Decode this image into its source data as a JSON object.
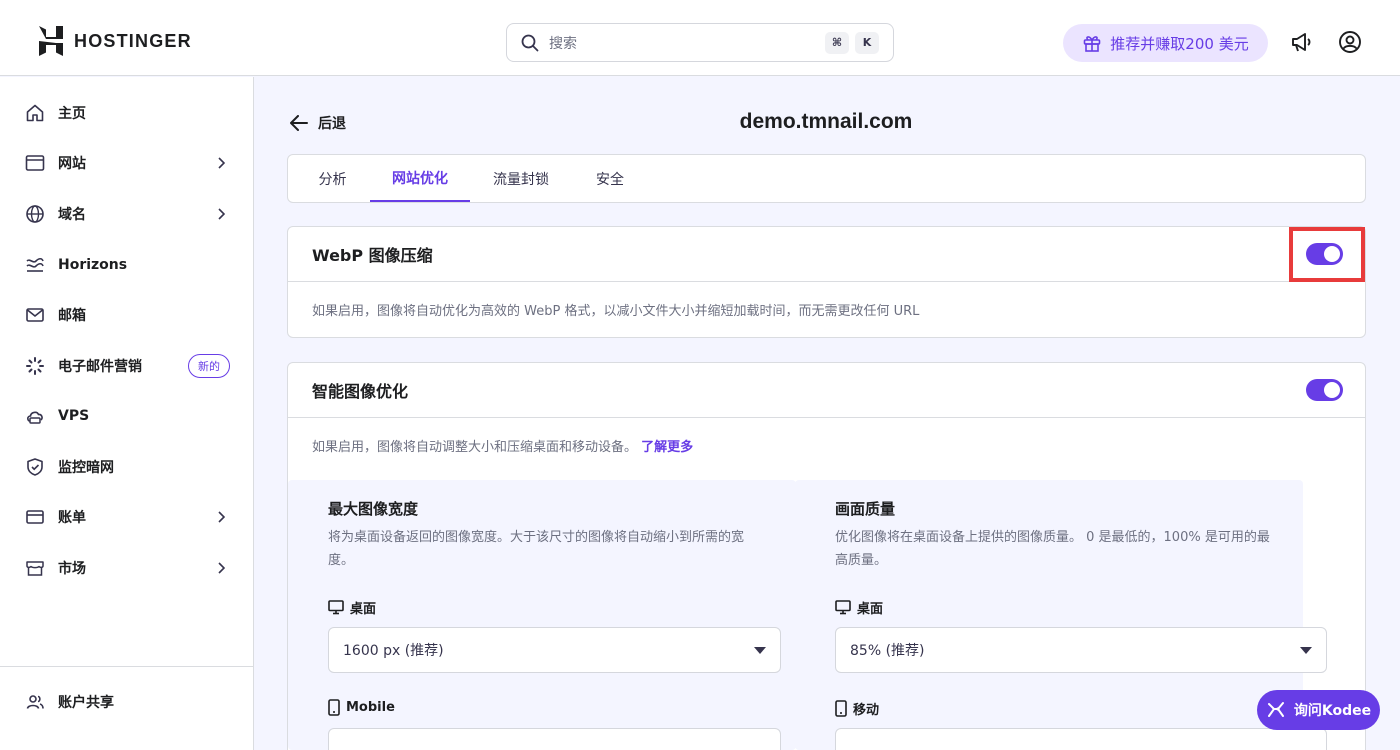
{
  "header": {
    "brand": "HOSTINGER",
    "search": {
      "placeholder": "搜索",
      "shortcut_key1": "⌘",
      "shortcut_key2": "K"
    },
    "referral_label": "推荐并赚取200 美元"
  },
  "sidebar": {
    "items": [
      {
        "label": "主页",
        "icon": "home-icon"
      },
      {
        "label": "网站",
        "icon": "browser-icon",
        "chevron": true
      },
      {
        "label": "域名",
        "icon": "globe-icon",
        "chevron": true
      },
      {
        "label": "Horizons",
        "icon": "horizons-icon"
      },
      {
        "label": "邮箱",
        "icon": "mail-icon"
      },
      {
        "label": "电子邮件营销",
        "icon": "email-marketing-icon",
        "badge": "新的"
      },
      {
        "label": "VPS",
        "icon": "cloud-server-icon"
      },
      {
        "label": "监控暗网",
        "icon": "shield-icon"
      },
      {
        "label": "账单",
        "icon": "billing-card-icon",
        "chevron": true
      },
      {
        "label": "市场",
        "icon": "store-icon",
        "chevron": true
      }
    ],
    "bottom_item": {
      "label": "账户共享",
      "icon": "users-icon"
    }
  },
  "main": {
    "back_label": "后退",
    "domain": "demo.tmnail.com",
    "tabs": [
      {
        "label": "分析",
        "active": false
      },
      {
        "label": "网站优化",
        "active": true
      },
      {
        "label": "流量封锁",
        "active": false
      },
      {
        "label": "安全",
        "active": false
      }
    ],
    "webp_card": {
      "title": "WebP 图像压缩",
      "enabled": true,
      "description": "如果启用，图像将自动优化为高效的 WebP 格式，以减小文件大小并缩短加载时间，而无需更改任何 URL"
    },
    "smart_card": {
      "title": "智能图像优化",
      "enabled": true,
      "description": "如果启用，图像将自动调整大小和压缩桌面和移动设备。",
      "learn_more": "了解更多",
      "width_panel": {
        "title": "最大图像宽度",
        "description": "将为桌面设备返回的图像宽度。大于该尺寸的图像将自动缩小到所需的宽度。",
        "desktop_label": "桌面",
        "desktop_value": "1600 px (推荐)",
        "mobile_label": "Mobile"
      },
      "quality_panel": {
        "title": "画面质量",
        "description": "优化图像将在桌面设备上提供的图像质量。 0 是最低的，100% 是可用的最高质量。",
        "desktop_label": "桌面",
        "desktop_value": "85% (推荐)",
        "mobile_label": "移动"
      }
    }
  },
  "assistant": {
    "label": "询问Kodee"
  },
  "colors": {
    "accent": "#673de6",
    "highlight": "#e83b3b"
  }
}
